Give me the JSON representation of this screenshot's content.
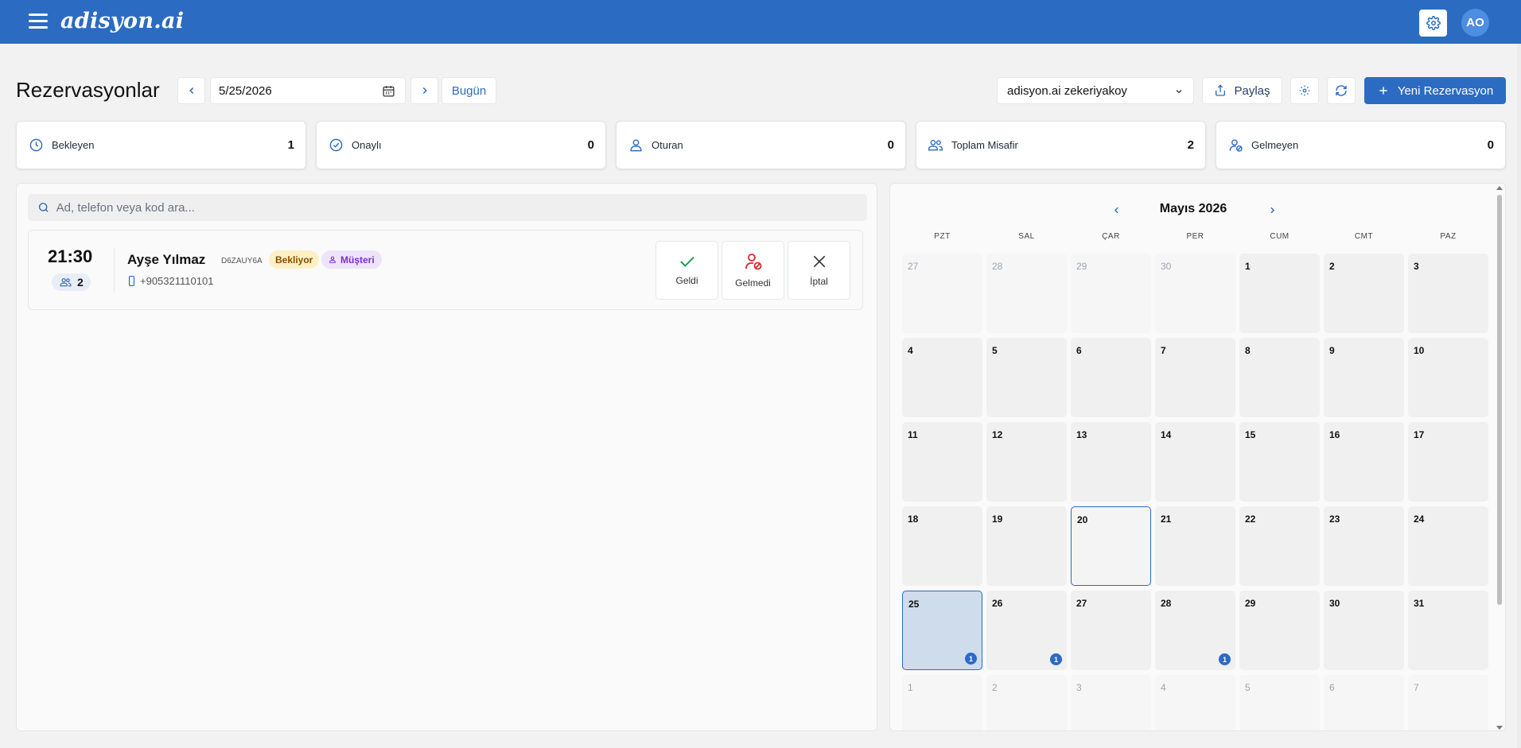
{
  "app": {
    "logo": "adisyon.ai",
    "avatar_initials": "AO"
  },
  "header": {
    "title": "Rezervasyonlar",
    "date_value": "5/25/2026",
    "today_label": "Bugün",
    "venue_selected": "adisyon.ai zekeriyakoy",
    "share_label": "Paylaş",
    "new_label": "Yeni Rezervasyon"
  },
  "stats": [
    {
      "label": "Bekleyen",
      "value": "1",
      "icon": "clock-icon"
    },
    {
      "label": "Onaylı",
      "value": "0",
      "icon": "check-circle-icon"
    },
    {
      "label": "Oturan",
      "value": "0",
      "icon": "user-icon"
    },
    {
      "label": "Toplam Misafir",
      "value": "2",
      "icon": "users-icon"
    },
    {
      "label": "Gelmeyen",
      "value": "0",
      "icon": "user-x-icon"
    }
  ],
  "search": {
    "placeholder": "Ad, telefon veya kod ara..."
  },
  "reservation": {
    "time": "21:30",
    "guests": "2",
    "name": "Ayşe Yılmaz",
    "code": "D6ZAUY6A",
    "status": "Bekliyor",
    "type": "Müşteri",
    "phone": "+905321110101",
    "actions": {
      "arrived": "Geldi",
      "no_show": "Gelmedi",
      "cancel": "İptal"
    }
  },
  "calendar": {
    "month_title": "Mayıs 2026",
    "weekdays": [
      "PZT",
      "SAL",
      "ÇAR",
      "PER",
      "CUM",
      "CMT",
      "PAZ"
    ],
    "weeks": [
      [
        "27",
        "28",
        "29",
        "30",
        "1",
        "2",
        "3"
      ],
      [
        "4",
        "5",
        "6",
        "7",
        "8",
        "9",
        "10"
      ],
      [
        "11",
        "12",
        "13",
        "14",
        "15",
        "16",
        "17"
      ],
      [
        "18",
        "19",
        "20",
        "21",
        "22",
        "23",
        "24"
      ],
      [
        "25",
        "26",
        "27",
        "28",
        "29",
        "30",
        "31"
      ],
      [
        "1",
        "2",
        "3",
        "4",
        "5",
        "6",
        "7"
      ]
    ],
    "badges": {
      "25": "1",
      "26": "1",
      "28": "1"
    }
  },
  "colors": {
    "primary": "#2c6bc2",
    "waiting_bg": "#fdf1c4",
    "customer_bg": "#ede4fb",
    "arrived": "#16a34a",
    "no_show": "#dc2626"
  }
}
